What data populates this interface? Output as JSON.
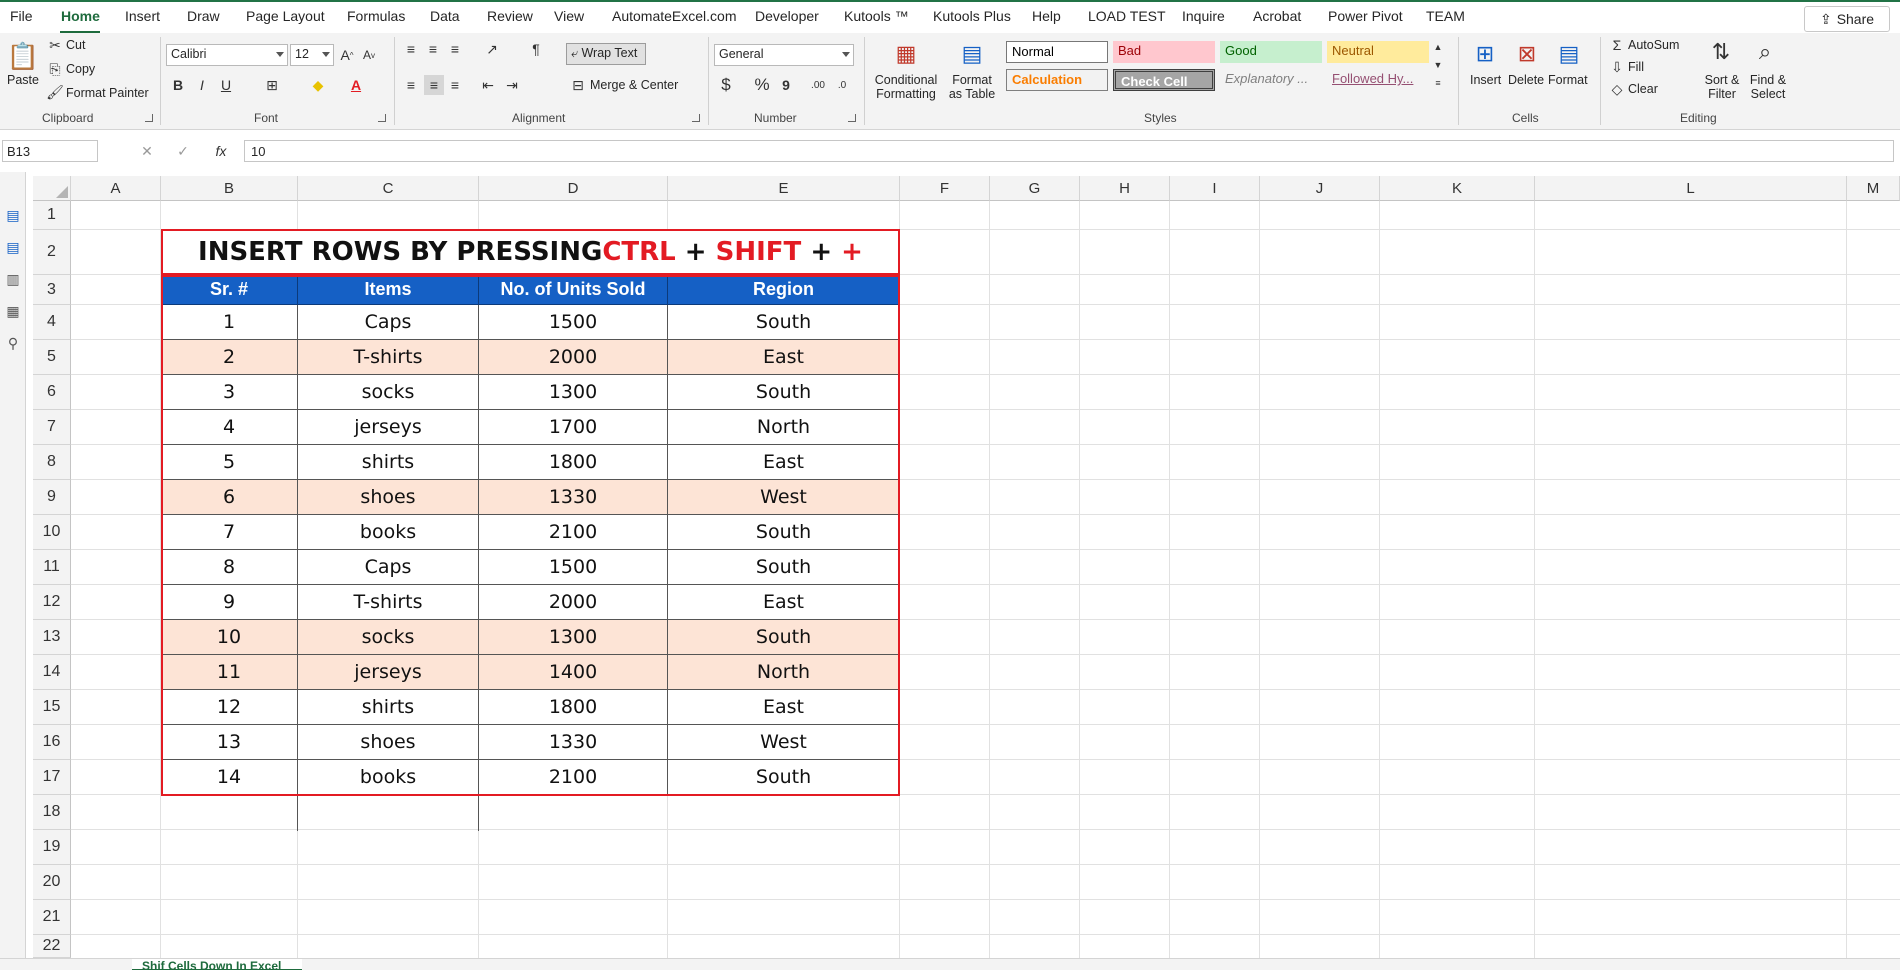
{
  "menu": {
    "items": [
      "File",
      "Home",
      "Insert",
      "Draw",
      "Page Layout",
      "Formulas",
      "Data",
      "Review",
      "View",
      "AutomateExcel.com",
      "Developer",
      "Kutools ™",
      "Kutools Plus",
      "Help",
      "LOAD TEST",
      "Inquire",
      "Acrobat",
      "Power Pivot",
      "TEAM"
    ],
    "share": "Share"
  },
  "ribbon": {
    "clipboard": {
      "paste": "Paste",
      "cut": "Cut",
      "copy": "Copy",
      "format_painter": "Format Painter",
      "label": "Clipboard"
    },
    "font": {
      "name": "Calibri",
      "size": "12",
      "label": "Font",
      "bold": "B",
      "italic": "I",
      "underline": "U"
    },
    "alignment": {
      "wrap": "Wrap Text",
      "merge": "Merge & Center",
      "label": "Alignment"
    },
    "number": {
      "format": "General",
      "currency": "$",
      "percent": "%",
      "comma": "9",
      "label": "Number"
    },
    "styles": {
      "conditional": "Conditional Formatting",
      "format_table": "Format as Table",
      "cells": [
        {
          "name": "Normal"
        },
        {
          "name": "Bad"
        },
        {
          "name": "Good"
        },
        {
          "name": "Neutral"
        },
        {
          "name": "Calculation"
        },
        {
          "name": "Check Cell"
        },
        {
          "name": "Explanatory ..."
        },
        {
          "name": "Followed Hy..."
        }
      ],
      "label": "Styles"
    },
    "cells": {
      "insert": "Insert",
      "delete": "Delete",
      "format": "Format",
      "label": "Cells"
    },
    "editing": {
      "autosum": "AutoSum",
      "fill": "Fill",
      "clear": "Clear",
      "sort": "Sort & Filter",
      "find": "Find & Select",
      "label": "Editing"
    }
  },
  "formula_bar": {
    "name_box": "B13",
    "fx": "fx",
    "value": "10"
  },
  "grid": {
    "columns": [
      "A",
      "B",
      "C",
      "D",
      "E",
      "F",
      "G",
      "H",
      "I",
      "J",
      "K",
      "L",
      "M"
    ],
    "rows": [
      "1",
      "2",
      "3",
      "4",
      "5",
      "6",
      "7",
      "8",
      "9",
      "10",
      "11",
      "12",
      "13",
      "14",
      "15",
      "16",
      "17",
      "18",
      "19",
      "20",
      "21",
      "22"
    ]
  },
  "table": {
    "title_part1": "INSERT ROWS BY PRESSING ",
    "title_ctrl": "CTRL",
    "title_plus1": " + ",
    "title_shift": "SHIFT",
    "title_plus2": " + ",
    "title_plus3": "+",
    "headers": [
      "Sr. #",
      "Items",
      "No. of Units Sold",
      "Region"
    ],
    "rows": [
      [
        "1",
        "Caps",
        "1500",
        "South"
      ],
      [
        "2",
        "T-shirts",
        "2000",
        "East"
      ],
      [
        "3",
        "socks",
        "1300",
        "South"
      ],
      [
        "4",
        "jerseys",
        "1700",
        "North"
      ],
      [
        "5",
        "shirts",
        "1800",
        "East"
      ],
      [
        "6",
        "shoes",
        "1330",
        "West"
      ],
      [
        "7",
        "books",
        "2100",
        "South"
      ],
      [
        "8",
        "Caps",
        "1500",
        "South"
      ],
      [
        "9",
        "T-shirts",
        "2000",
        "East"
      ],
      [
        "10",
        "socks",
        "1300",
        "South"
      ],
      [
        "11",
        "jerseys",
        "1400",
        "North"
      ],
      [
        "12",
        "shirts",
        "1800",
        "East"
      ],
      [
        "13",
        "shoes",
        "1330",
        "West"
      ],
      [
        "14",
        "books",
        "2100",
        "South"
      ]
    ],
    "highlighted_rows": [
      1,
      5,
      9,
      10
    ]
  },
  "sheet_tab": "Shif Cells Down In Excel",
  "colors": {
    "accent": "#217346",
    "header_blue": "#1560c5",
    "title_red": "#e31b23",
    "row_highlight": "#fde4d6"
  }
}
